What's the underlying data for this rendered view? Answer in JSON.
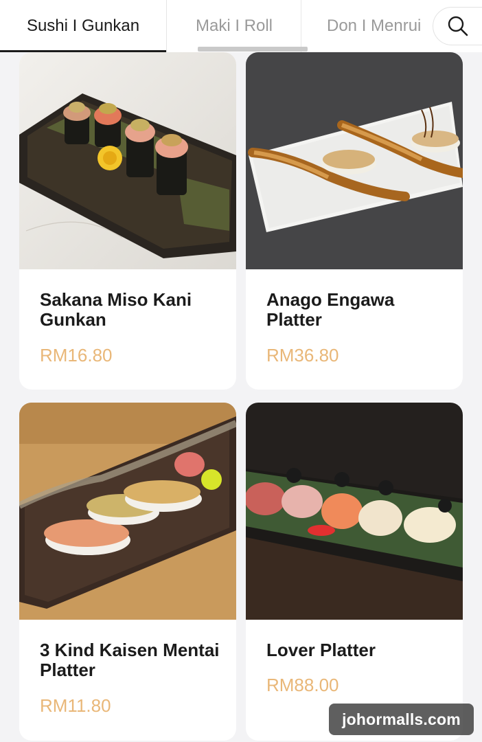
{
  "tabs": {
    "items": [
      {
        "label": "Sushi I Gunkan",
        "active": true
      },
      {
        "label": "Maki I Roll",
        "active": false
      },
      {
        "label": "Don I Menrui",
        "active": false
      }
    ],
    "search_icon": "search-icon"
  },
  "menu": {
    "items": [
      {
        "name": "Sakana Miso Kani Gunkan",
        "price": "RM16.80",
        "photo": "gunkan-sushi-photo"
      },
      {
        "name": "Anago Engawa Platter",
        "price": "RM36.80",
        "photo": "anago-engawa-photo"
      },
      {
        "name": "3 Kind Kaisen Mentai Platter",
        "price": "RM11.80",
        "photo": "aburi-mentai-photo"
      },
      {
        "name": "Lover Platter",
        "price": "RM88.00",
        "photo": "lover-platter-photo"
      }
    ]
  },
  "watermark": {
    "text": "johormalls.com"
  },
  "colors": {
    "price": "#e9b778",
    "active_tab": "#1b1b1b",
    "inactive_tab": "#9a9a9a",
    "background": "#f3f3f5"
  }
}
